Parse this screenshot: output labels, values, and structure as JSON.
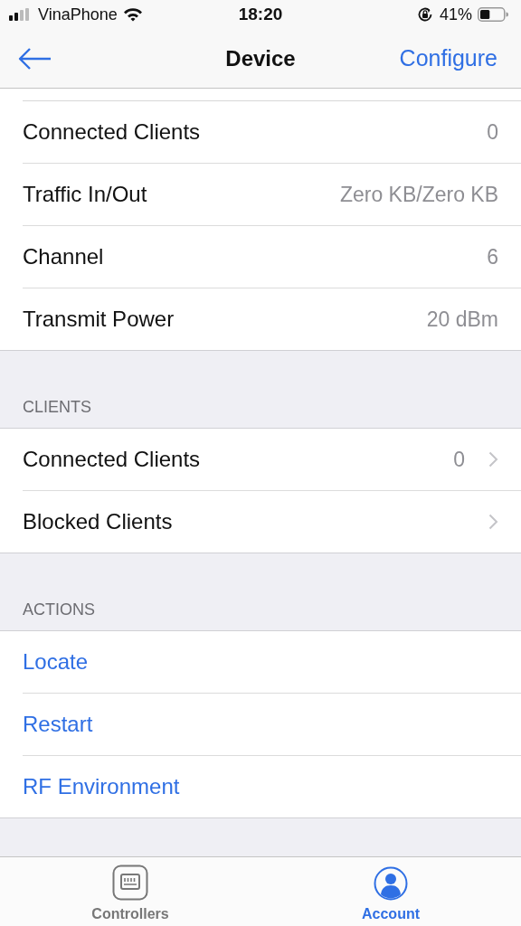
{
  "status_bar": {
    "carrier": "VinaPhone",
    "time": "18:20",
    "battery": "41%"
  },
  "nav": {
    "title": "Device",
    "action": "Configure"
  },
  "sections": [
    {
      "rows": [
        {
          "kind": "detail",
          "label": "Connected Clients",
          "value": "0"
        },
        {
          "kind": "detail",
          "label": "Traffic In/Out",
          "value": "Zero KB/Zero KB"
        },
        {
          "kind": "detail",
          "label": "Channel",
          "value": "6"
        },
        {
          "kind": "detail",
          "label": "Transmit Power",
          "value": "20 dBm"
        }
      ]
    },
    {
      "header": "CLIENTS",
      "rows": [
        {
          "kind": "link",
          "label": "Connected Clients",
          "value": "0"
        },
        {
          "kind": "link",
          "label": "Blocked Clients"
        }
      ]
    },
    {
      "header": "ACTIONS",
      "rows": [
        {
          "kind": "action",
          "label": "Locate"
        },
        {
          "kind": "action",
          "label": "Restart"
        },
        {
          "kind": "action",
          "label": "RF Environment"
        }
      ]
    }
  ],
  "tab_bar": [
    {
      "kind": "controllers",
      "label": "Controllers",
      "selected": false
    },
    {
      "kind": "account",
      "label": "Account",
      "selected": true
    }
  ]
}
